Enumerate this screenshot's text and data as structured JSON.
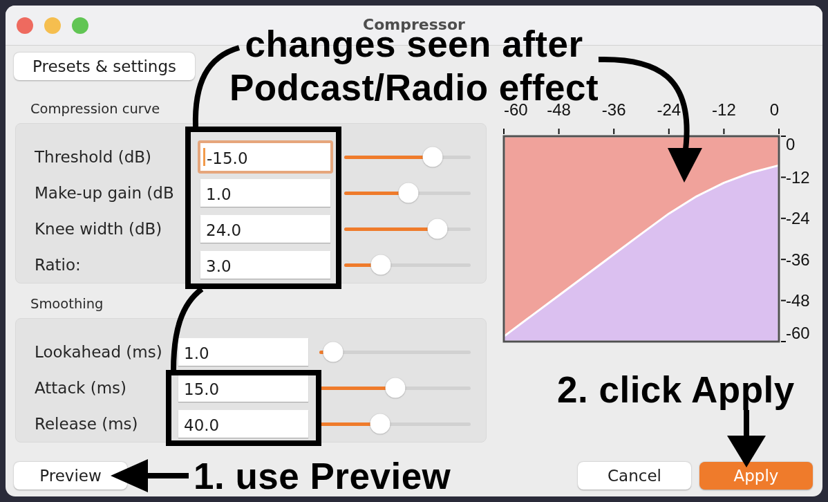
{
  "window": {
    "title": "Compressor",
    "controls": [
      {
        "color": "#ee6a5f"
      },
      {
        "color": "#f5be4f"
      },
      {
        "color": "#61c554"
      }
    ]
  },
  "presets_button": "Presets & settings",
  "sections": [
    {
      "title": "Compression curve",
      "rows": [
        {
          "label": "Threshold (dB)",
          "value": "-15.0",
          "focused": true,
          "level": 0.7
        },
        {
          "label": "Make-up gain (dB",
          "value": "1.0",
          "focused": false,
          "level": 0.51
        },
        {
          "label": "Knee width (dB)",
          "value": "24.0",
          "focused": false,
          "level": 0.74
        },
        {
          "label": "Ratio:",
          "value": "3.0",
          "focused": false,
          "level": 0.29
        }
      ]
    },
    {
      "title": "Smoothing",
      "rows": [
        {
          "label": "Lookahead (ms)",
          "value": "1.0",
          "focused": false,
          "level": 0.09
        },
        {
          "label": "Attack (ms)",
          "value": "15.0",
          "focused": false,
          "level": 0.5
        },
        {
          "label": "Release (ms)",
          "value": "40.0",
          "focused": false,
          "level": 0.4
        }
      ]
    }
  ],
  "curve_graph": {
    "chart_data": {
      "type": "area",
      "x": [
        -60,
        -60,
        -54,
        -48,
        -42,
        -36,
        -30,
        -24,
        -18,
        -12,
        -6,
        0,
        0
      ],
      "series": [
        {
          "color": "#f0a29b",
          "values": [
            -60,
            0,
            0,
            0,
            0,
            0,
            0,
            0,
            0,
            0,
            0,
            0,
            -60
          ]
        },
        {
          "color": "#dbc0f0",
          "values": [
            -60,
            -58.5,
            -52.5,
            -46.5,
            -40.5,
            -34.5,
            -28.5,
            -22.6,
            -17.6,
            -13.6,
            -10.6,
            -8.5,
            -60
          ]
        }
      ],
      "xlim": [
        -60,
        0
      ],
      "ylim": [
        -60,
        0
      ],
      "xticks": [
        -60,
        -48,
        -36,
        -24,
        -12,
        0
      ],
      "yticks": [
        0,
        -12,
        -24,
        -36,
        -48,
        -60
      ]
    }
  },
  "footer": {
    "left_buttons": [
      {
        "label": "Preview",
        "kind": "default"
      }
    ],
    "right_buttons": [
      {
        "label": "Cancel",
        "kind": "default"
      },
      {
        "label": "Apply",
        "kind": "primary"
      }
    ]
  },
  "annotations": [
    {
      "lines": [
        "changes seen after",
        "Podcast/Radio effect"
      ]
    },
    {
      "lines": [
        "2. click Apply"
      ]
    },
    {
      "lines": [
        "1. use Preview"
      ]
    }
  ]
}
